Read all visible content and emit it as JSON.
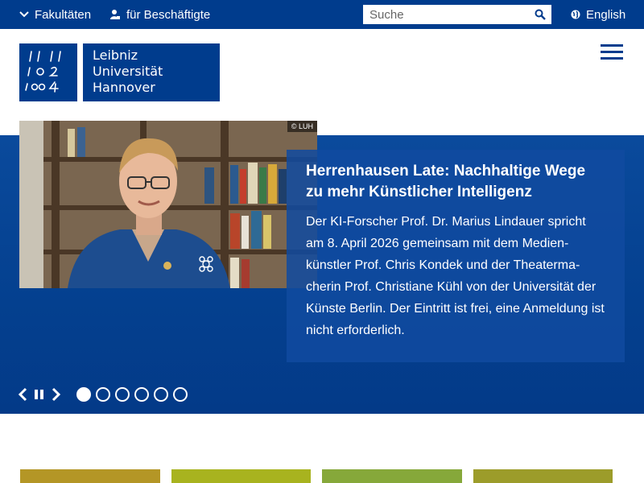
{
  "topbar": {
    "faculties_label": "Fakultäten",
    "staff_label": "für Beschäftigte",
    "search_placeholder": "Suche",
    "language_label": "English"
  },
  "logo": {
    "line1": "Leibniz",
    "line2": "Universität",
    "line3": "Hannover"
  },
  "hero": {
    "photo_credit": "© LUH",
    "title": "Herrenhausen Late: Nachhaltige Wege zu mehr Künstlicher Intelligenz",
    "text": "Der KI-Forscher Prof. Dr. Marius Lindauer spricht am 8. April 2026 gemeinsam mit dem Medien­künstler Prof. Chris Kondek und der Theaterma­cherin Prof. Christiane Kühl von der Universität der Künste Berlin. Der Eintritt ist frei, eine Anmel­dung ist nicht erforderlich.",
    "slide_count": 6,
    "active_slide": 1
  },
  "colors": {
    "brand_blue": "#003c8d",
    "tile_1": "#b49626",
    "tile_2": "#a8b31f",
    "tile_3": "#86a83a",
    "tile_4": "#9c9c2a"
  },
  "icons": {
    "faculties": "chevron-down-icon",
    "staff": "person-icon",
    "search": "search-icon",
    "language": "globe-icon",
    "menu": "hamburger-icon",
    "prev": "chevron-left-icon",
    "pause": "pause-icon",
    "next": "chevron-right-icon"
  }
}
